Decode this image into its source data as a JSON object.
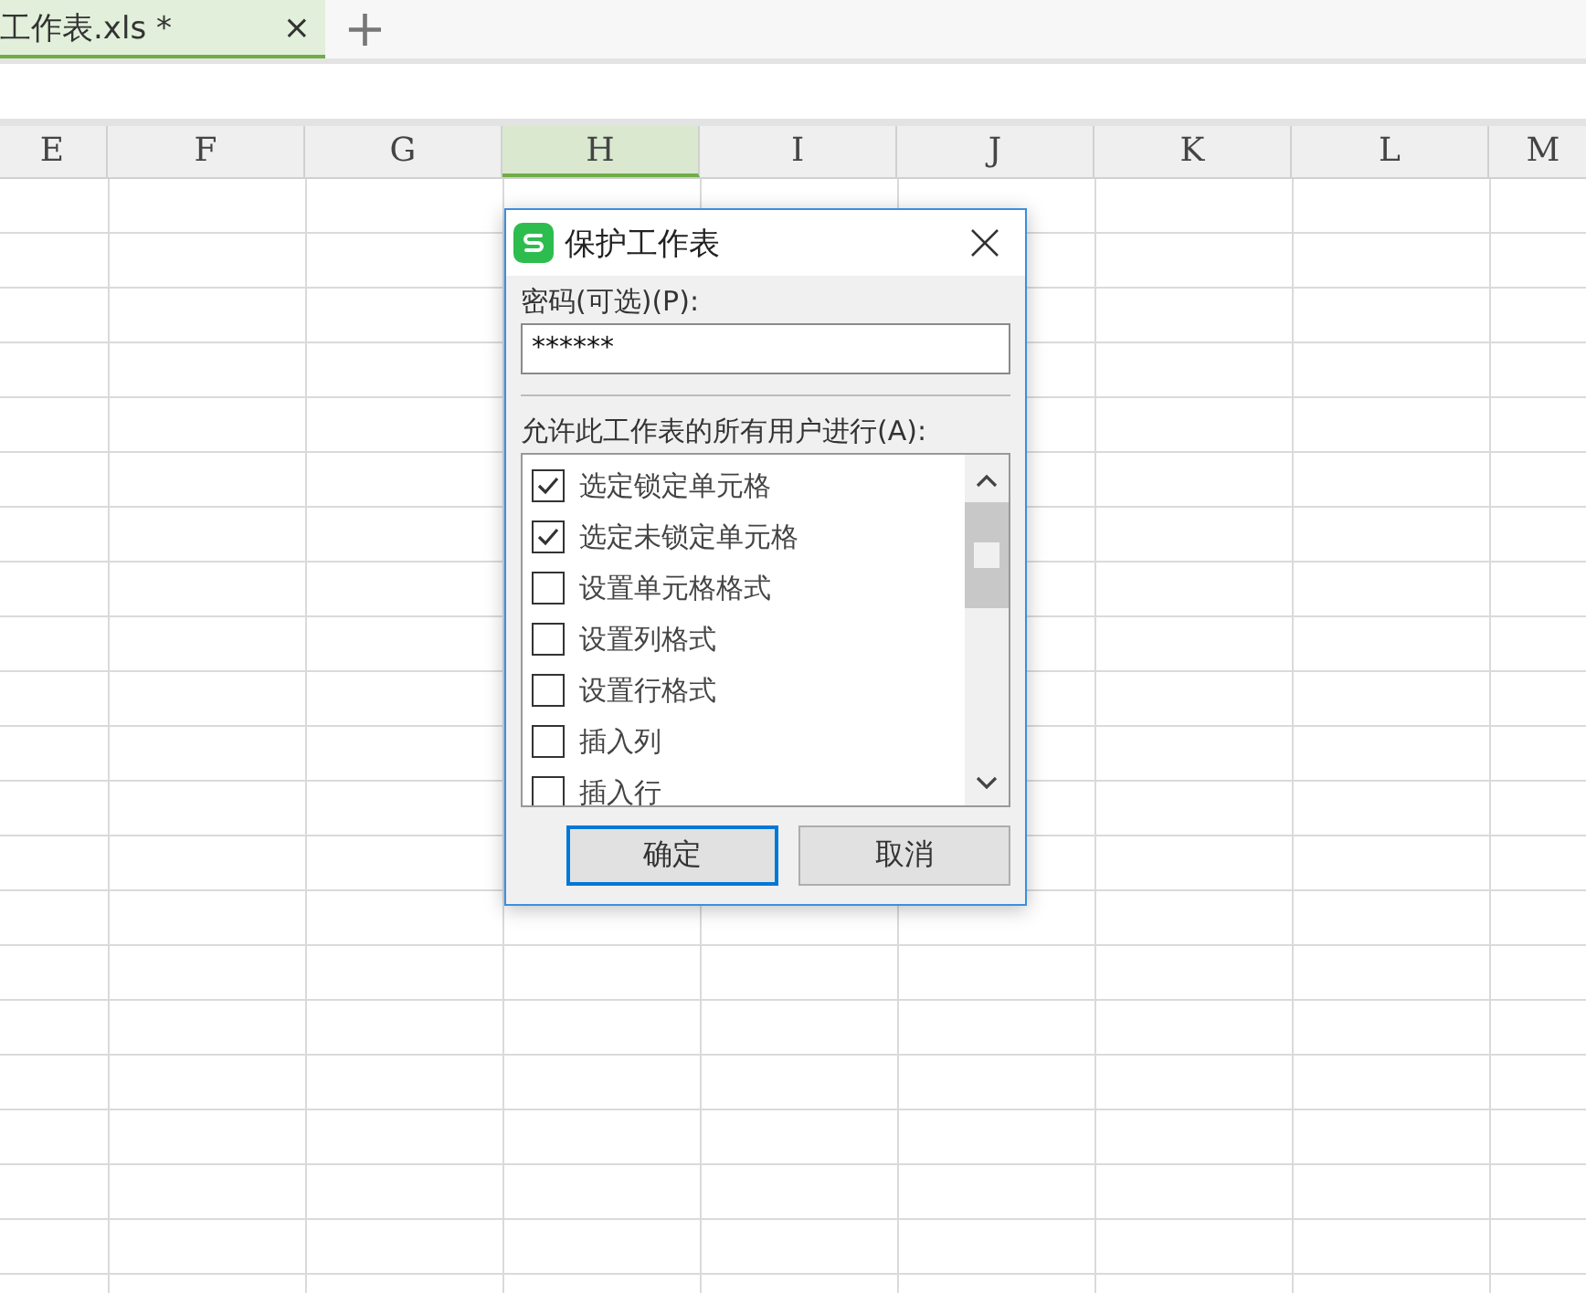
{
  "tabs": [
    {
      "label": "工作表.xls *",
      "selected": true,
      "close": "×"
    }
  ],
  "new_tab": "+",
  "columns": [
    {
      "label": "E",
      "selected": false
    },
    {
      "label": "F",
      "selected": false
    },
    {
      "label": "G",
      "selected": false
    },
    {
      "label": "H",
      "selected": true
    },
    {
      "label": "I",
      "selected": false
    },
    {
      "label": "J",
      "selected": false
    },
    {
      "label": "K",
      "selected": false
    },
    {
      "label": "L",
      "selected": false
    },
    {
      "label": "M",
      "selected": false
    }
  ],
  "dialog": {
    "title": "保护工作表",
    "password_label": "密码(可选)(P):",
    "password_value": "******",
    "permissions_label": "允许此工作表的所有用户进行(A):",
    "permissions": [
      {
        "label": "选定锁定单元格",
        "checked": true
      },
      {
        "label": "选定未锁定单元格",
        "checked": true
      },
      {
        "label": "设置单元格格式",
        "checked": false
      },
      {
        "label": "设置列格式",
        "checked": false
      },
      {
        "label": "设置行格式",
        "checked": false
      },
      {
        "label": "插入列",
        "checked": false
      },
      {
        "label": "插入行",
        "checked": false
      }
    ],
    "buttons": [
      {
        "label": "确定",
        "selected": true
      },
      {
        "label": "取消",
        "selected": false
      }
    ]
  }
}
